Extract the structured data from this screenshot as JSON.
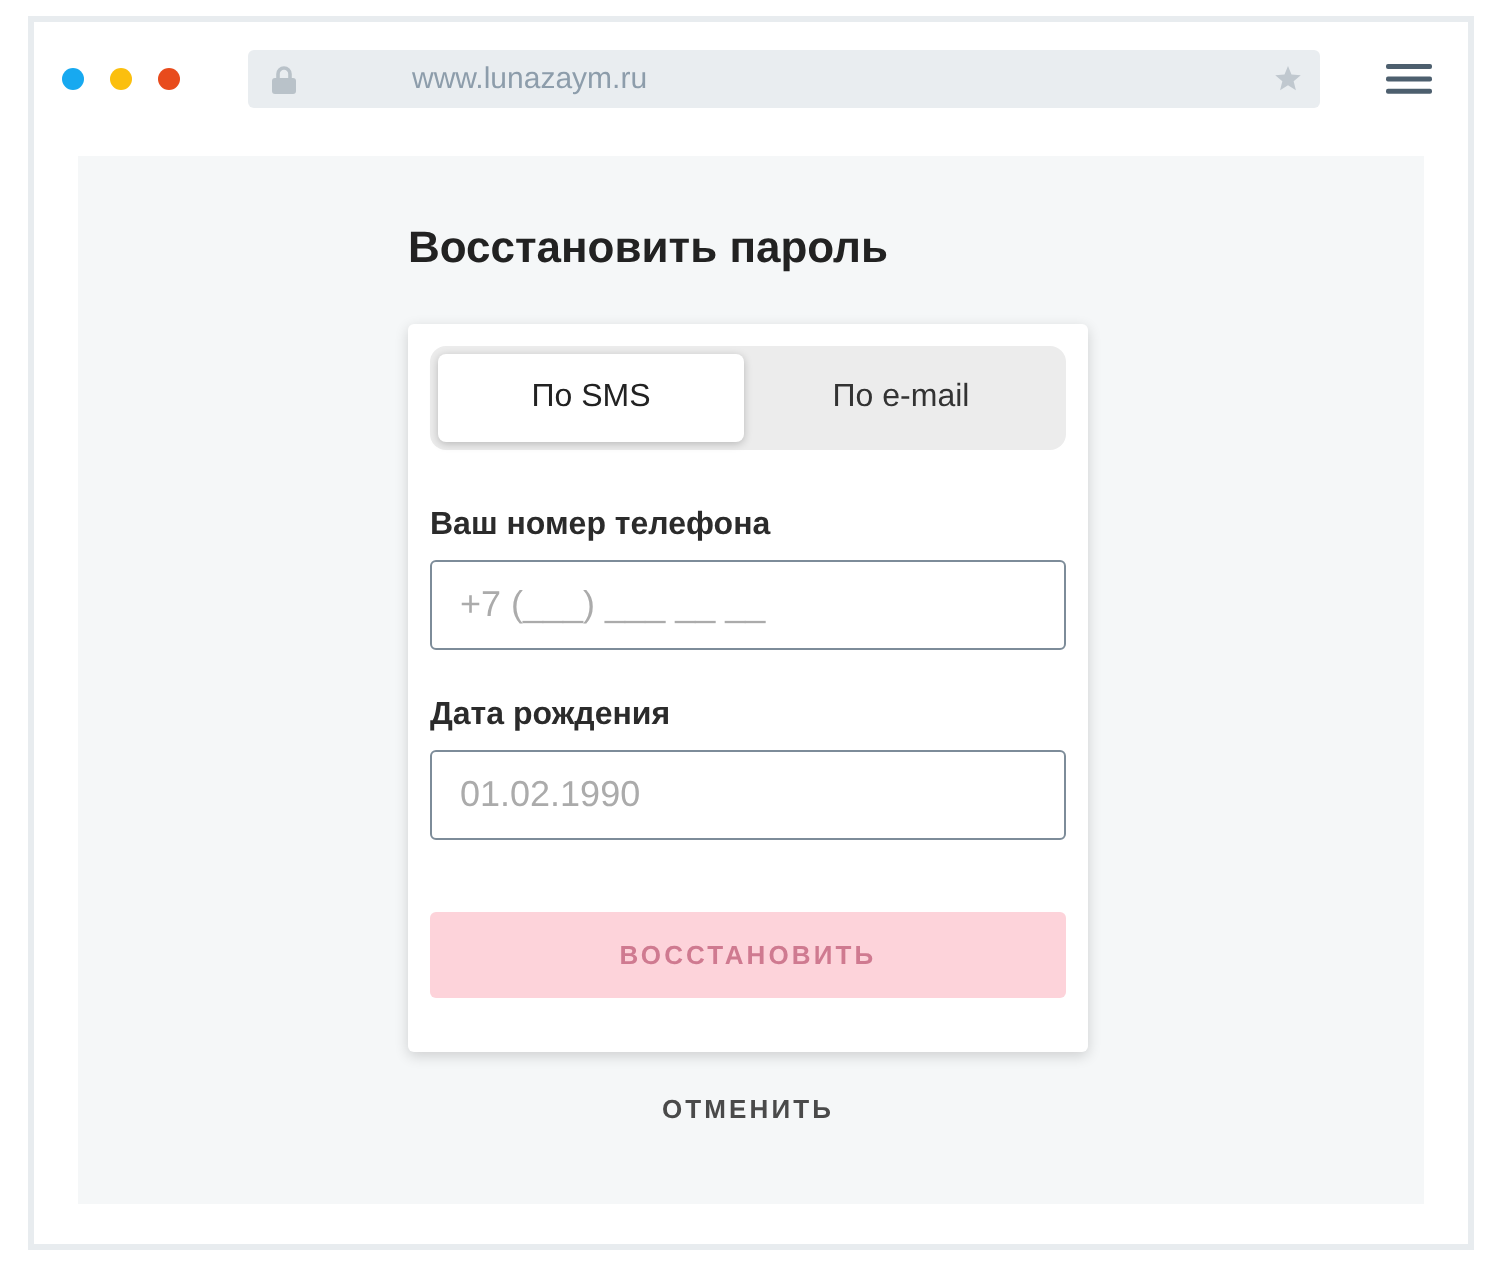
{
  "browser": {
    "window_dots": [
      {
        "color": "#17a9f0"
      },
      {
        "color": "#fbbf0e"
      },
      {
        "color": "#e84b1c"
      }
    ],
    "address": "www.lunazaym.ru"
  },
  "page": {
    "title": "Восстановить пароль",
    "tabs": [
      {
        "label": "По SMS",
        "selected": true
      },
      {
        "label": "По e-mail",
        "selected": false
      }
    ],
    "fields": [
      {
        "label": "Ваш номер телефона",
        "placeholder": "+7 (___) ___ __ __"
      },
      {
        "label": "Дата рождения",
        "placeholder": "01.02.1990"
      }
    ],
    "submit": {
      "label": "ВОССТАНОВИТЬ",
      "disabled": true
    },
    "cancel": "ОТМЕНИТЬ"
  }
}
